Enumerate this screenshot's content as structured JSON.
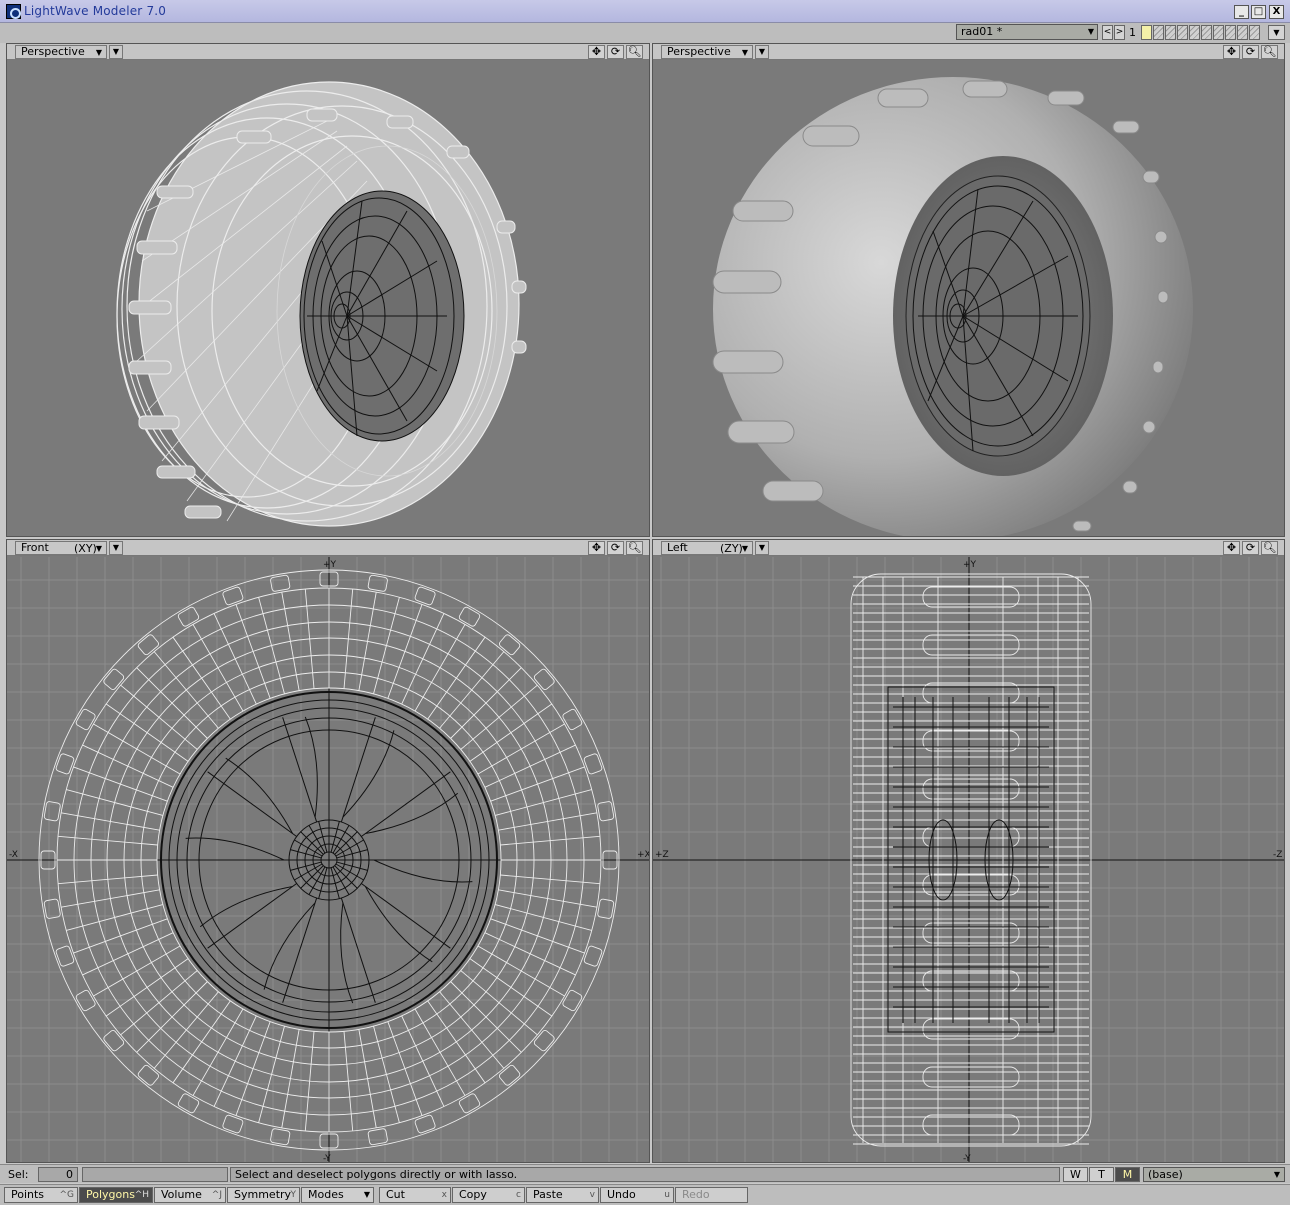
{
  "window": {
    "title": "LightWave Modeler 7.0",
    "icon": "lightwave-icon",
    "controls": {
      "minimize": "_",
      "maximize": "□",
      "close": "X"
    }
  },
  "layer_bar": {
    "object_name": "rad01 *",
    "prev": "<",
    "next": ">",
    "layer_number": "1"
  },
  "viewports": [
    {
      "label": "Perspective",
      "axis": "",
      "mode": "wireframe",
      "icons": [
        "move-view-icon",
        "rotate-view-icon",
        "zoom-view-icon"
      ]
    },
    {
      "label": "Perspective",
      "axis": "",
      "mode": "smooth-shade",
      "icons": [
        "move-view-icon",
        "rotate-view-icon",
        "zoom-view-icon"
      ]
    },
    {
      "label": "Front",
      "axis": "(XY)",
      "mode": "wireframe",
      "axis_labels": {
        "top": "+Y",
        "bottom": "-Y",
        "left": "-X",
        "right": "+X"
      },
      "icons": [
        "move-view-icon",
        "rotate-view-icon",
        "zoom-view-icon"
      ]
    },
    {
      "label": "Left",
      "axis": "(ZY)",
      "mode": "wireframe",
      "axis_labels": {
        "top": "+Y",
        "bottom": "-Y",
        "left": "+Z",
        "right": "-Z"
      },
      "icons": [
        "move-view-icon",
        "rotate-view-icon",
        "zoom-view-icon"
      ]
    }
  ],
  "status": {
    "sel_label": "Sel:",
    "sel_count": "0",
    "message": "Select and deselect polygons directly or with lasso.",
    "wtm": [
      "W",
      "T",
      "M"
    ],
    "surface": "(base)"
  },
  "bottom_buttons": [
    {
      "label": "Points",
      "key": "^G",
      "state": "normal"
    },
    {
      "label": "Polygons",
      "key": "^H",
      "state": "active"
    },
    {
      "label": "Volume",
      "key": "^J",
      "state": "normal"
    },
    {
      "label": "Symmetry",
      "key": "Y",
      "state": "normal"
    },
    {
      "label": "Modes",
      "key": "",
      "state": "normal"
    },
    {
      "label": "Cut",
      "key": "x",
      "state": "normal"
    },
    {
      "label": "Copy",
      "key": "c",
      "state": "normal"
    },
    {
      "label": "Paste",
      "key": "v",
      "state": "normal"
    },
    {
      "label": "Undo",
      "key": "u",
      "state": "normal"
    },
    {
      "label": "Redo",
      "key": "",
      "state": "disabled"
    }
  ],
  "colors": {
    "viewport_bg": "#7a7a7a",
    "grid": "#8c8c8c",
    "wire_white": "#ececec",
    "wire_black": "#111111",
    "active_button": "#4c4c4c"
  }
}
